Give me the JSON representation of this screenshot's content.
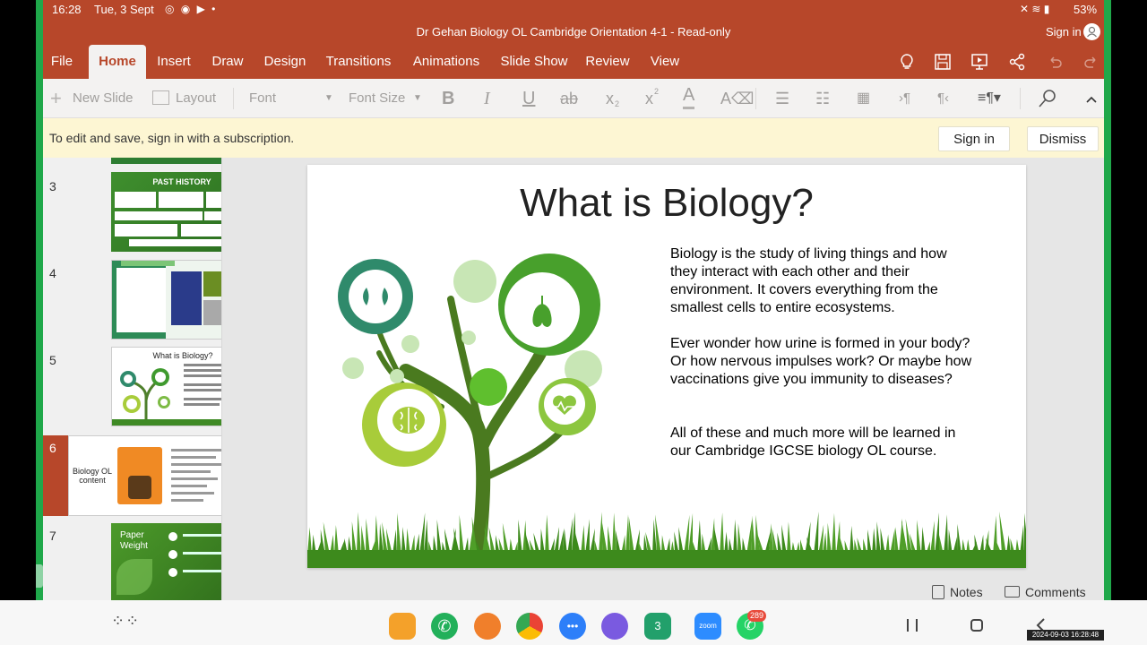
{
  "status": {
    "time": "16:28",
    "date": "Tue, 3 Sept",
    "battery": "53%"
  },
  "title": {
    "text": "Dr Gehan Biology OL Cambridge Orientation 4-1 - Read-only",
    "sign_in": "Sign in"
  },
  "tabs": [
    "File",
    "Home",
    "Insert",
    "Draw",
    "Design",
    "Transitions",
    "Animations",
    "Slide Show",
    "Review",
    "View"
  ],
  "ribbon": {
    "new_slide": "New Slide",
    "layout": "Layout",
    "font": "Font",
    "font_size": "Font Size",
    "bold": "B",
    "italic": "I",
    "underline": "U",
    "strike": "ab",
    "subscript": "x",
    "superscript": "x",
    "font_color": "A"
  },
  "message_bar": {
    "text": "To edit and save, sign in with a subscription.",
    "sign_in": "Sign in",
    "dismiss": "Dismiss"
  },
  "thumbnails": [
    {
      "num": "3",
      "title": "PAST HISTORY"
    },
    {
      "num": "4",
      "title": ""
    },
    {
      "num": "5",
      "title": "What is Biology?"
    },
    {
      "num": "6",
      "title": "Biology OL content"
    },
    {
      "num": "7",
      "title": "Paper Weight"
    }
  ],
  "slide": {
    "title": "What is Biology?",
    "para1": "Biology is the study of living things and how they interact with each other and their environment. It covers everything from the smallest cells to entire ecosystems.",
    "para2": "Ever wonder how urine is formed in your body? Or how nervous impulses work? Or maybe how vaccinations give you immunity to diseases?",
    "para3": "All of these and much more will be learned in our Cambridge IGCSE biology OL course."
  },
  "footer": {
    "notes": "Notes",
    "comments": "Comments"
  },
  "dock": {
    "whatsapp_badge": "289",
    "calendar_day": "3",
    "zoom_label": "zoom"
  },
  "overlay_timestamp": "2024-09-03 16:28:48",
  "colors": {
    "accent": "#b7472a",
    "frame": "#1fa84a"
  }
}
